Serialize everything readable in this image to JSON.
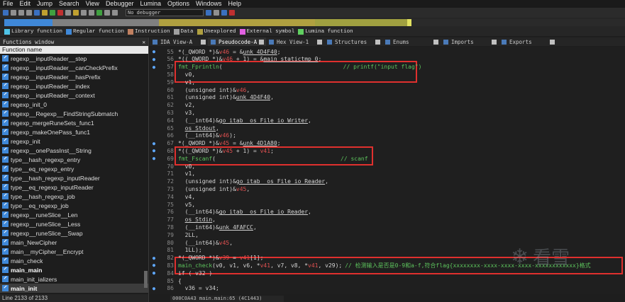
{
  "menu": [
    "File",
    "Edit",
    "Jump",
    "Search",
    "View",
    "Debugger",
    "Lumina",
    "Options",
    "Windows",
    "Help"
  ],
  "toolbar": {
    "debugger_select": "No debugger"
  },
  "legend": [
    {
      "label": "Library function",
      "color": "#4fc4e8"
    },
    {
      "label": "Regular function",
      "color": "#3f88d8"
    },
    {
      "label": "Instruction",
      "color": "#c08060"
    },
    {
      "label": "Data",
      "color": "#a0a0a0"
    },
    {
      "label": "Unexplored",
      "color": "#b0a040"
    },
    {
      "label": "External symbol",
      "color": "#e060e0"
    },
    {
      "label": "Lumina function",
      "color": "#60d060"
    }
  ],
  "functions": {
    "title": "Functions window",
    "column": "Function name",
    "items": [
      "regexp__inputReader__step",
      "regexp__inputReader__canCheckPrefix",
      "regexp__inputReader__hasPrefix",
      "regexp__inputReader__index",
      "regexp__inputReader__context",
      "regexp_init_0",
      "regexp__Regexp__FindStringSubmatch",
      "regexp_mergeRuneSets_func1",
      "regexp_makeOnePass_func1",
      "regexp_init",
      "regexp__onePassInst__String",
      "type__hash_regexp_entry",
      "type__eq_regexp_entry",
      "type__hash_regexp_inputReader",
      "type__eq_regexp_inputReader",
      "type__hash_regexp_job",
      "type__eq_regexp_job",
      "regexp__runeSlice__Len",
      "regexp__runeSlice__Less",
      "regexp__runeSlice__Swap",
      "main_NewCipher",
      "main__myCipher__Encrypt",
      "main_check",
      "main_main",
      "main_init_ializers",
      "main_init"
    ],
    "status": "Line 2133 of 2133"
  },
  "tabs": [
    "IDA View-A",
    "Pseudocode-A",
    "Hex View-1",
    "Structures",
    "Enums",
    "Imports",
    "Exports"
  ],
  "code": [
    {
      "n": "55",
      "t": "*(_QWORD *)&v46 = &unk_4D4F40;"
    },
    {
      "n": "56",
      "t": "*((_QWORD *)&v46 + 1) = &main_statictmp_0;"
    },
    {
      "n": "57",
      "t": "fmt_Fprintln(",
      "c": "// printf(\"input flag\")"
    },
    {
      "n": "58",
      "t": "  v0,"
    },
    {
      "n": "59",
      "t": "  v1,"
    },
    {
      "n": "60",
      "t": "  (unsigned int)&v46,"
    },
    {
      "n": "61",
      "t": "  (unsigned int)&unk_4D4F40,"
    },
    {
      "n": "62",
      "t": "  v2,"
    },
    {
      "n": "63",
      "t": "  v3,"
    },
    {
      "n": "64",
      "t": "  (__int64)&go_itab__os_File_io_Writer,"
    },
    {
      "n": "65",
      "t": "  os_Stdout,"
    },
    {
      "n": "66",
      "t": "  (__int64)&v46);"
    },
    {
      "n": "67",
      "t": "*(_QWORD *)&v45 = &unk_4D1A80;"
    },
    {
      "n": "68",
      "t": "*((_QWORD *)&v45 + 1) = v41;"
    },
    {
      "n": "69",
      "t": "fmt_Fscanf(",
      "c": "// scanf"
    },
    {
      "n": "70",
      "t": "  v0,"
    },
    {
      "n": "71",
      "t": "  v1,"
    },
    {
      "n": "72",
      "t": "  (unsigned int)&go_itab__os_File_io_Reader,"
    },
    {
      "n": "73",
      "t": "  (unsigned int)&v45,"
    },
    {
      "n": "74",
      "t": "  v4,"
    },
    {
      "n": "75",
      "t": "  v5,"
    },
    {
      "n": "76",
      "t": "  (__int64)&go_itab__os_File_io_Reader,"
    },
    {
      "n": "77",
      "t": "  os_Stdin,"
    },
    {
      "n": "78",
      "t": "  (__int64)&unk_4FAFCC,"
    },
    {
      "n": "79",
      "t": "  2LL,"
    },
    {
      "n": "80",
      "t": "  (__int64)&v45,"
    },
    {
      "n": "81",
      "t": "  1LL);"
    },
    {
      "n": "82",
      "t": "*(_QWORD *)&v39 = v41[1];"
    },
    {
      "n": "83",
      "t": "main_check(v0, v1, v6, *v41, v7, v8, *v41, v29);",
      "c": "// 检测输入是否是0-9和a-f,符合flag{xxxxxxxx-xxxx-xxxx-xxxx-xxxxxxxxxxxx}格式"
    },
    {
      "n": "84",
      "t": "if ( v32 )"
    },
    {
      "n": "85",
      "t": "{"
    },
    {
      "n": "86",
      "t": "  v36 = v34;"
    }
  ],
  "code_status": "000C0A43 main.main:65 (4C1443)",
  "watermark": "看雪"
}
